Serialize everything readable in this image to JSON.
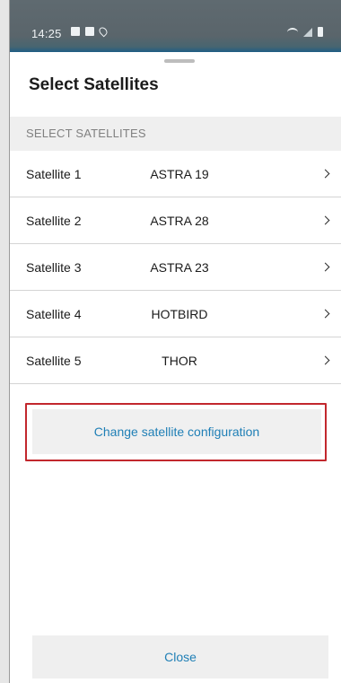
{
  "statusbar": {
    "time": "14:25",
    "left_icons": [
      "gallery-icon",
      "app-icon",
      "location-icon"
    ],
    "right_icons": [
      "wifi-icon",
      "signal-icon",
      "battery-icon"
    ]
  },
  "sheet": {
    "title": "Select Satellites",
    "section_header": "SELECT SATELLITES",
    "items": [
      {
        "label": "Satellite 1",
        "value": "ASTRA 19"
      },
      {
        "label": "Satellite 2",
        "value": "ASTRA 28"
      },
      {
        "label": "Satellite 3",
        "value": "ASTRA 23"
      },
      {
        "label": "Satellite 4",
        "value": "HOTBIRD"
      },
      {
        "label": "Satellite 5",
        "value": "THOR"
      }
    ],
    "change_button_label": "Change satellite configuration",
    "close_button_label": "Close"
  },
  "colors": {
    "accent": "#1f7fb6",
    "highlight_border": "#c2272d",
    "section_header_bg": "#efefef"
  }
}
